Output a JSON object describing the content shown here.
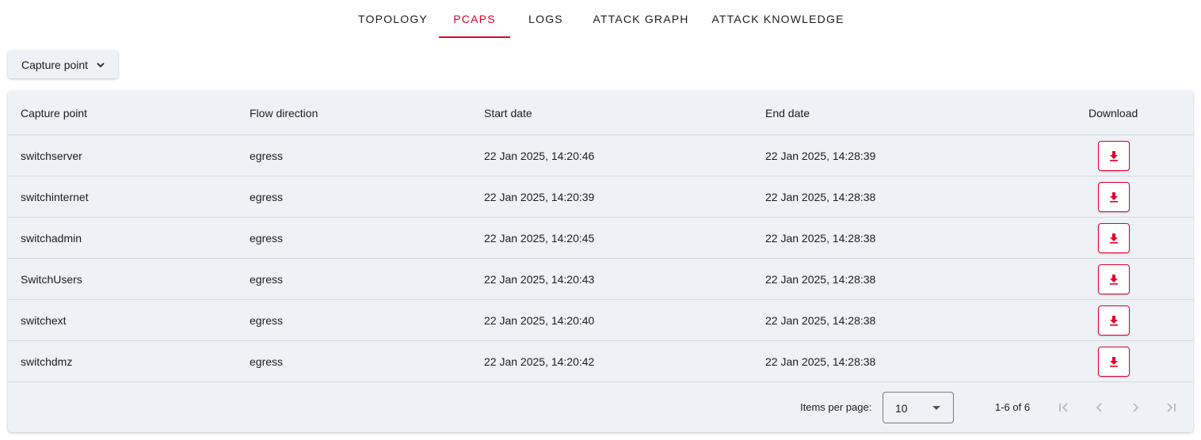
{
  "tabs": [
    {
      "label": "TOPOLOGY",
      "active": false
    },
    {
      "label": "PCAPS",
      "active": true
    },
    {
      "label": "LOGS",
      "active": false
    },
    {
      "label": "ATTACK GRAPH",
      "active": false
    },
    {
      "label": "ATTACK KNOWLEDGE",
      "active": false
    }
  ],
  "filter": {
    "label": "Capture point",
    "icon": "chevron-down-icon"
  },
  "table": {
    "headers": {
      "capture_point": "Capture point",
      "flow_direction": "Flow direction",
      "start_date": "Start date",
      "end_date": "End date",
      "download": "Download"
    },
    "rows": [
      {
        "capture_point": "switchserver",
        "flow_direction": "egress",
        "start_date": "22 Jan 2025, 14:20:46",
        "end_date": "22 Jan 2025, 14:28:39"
      },
      {
        "capture_point": "switchinternet",
        "flow_direction": "egress",
        "start_date": "22 Jan 2025, 14:20:39",
        "end_date": "22 Jan 2025, 14:28:38"
      },
      {
        "capture_point": "switchadmin",
        "flow_direction": "egress",
        "start_date": "22 Jan 2025, 14:20:45",
        "end_date": "22 Jan 2025, 14:28:38"
      },
      {
        "capture_point": "SwitchUsers",
        "flow_direction": "egress",
        "start_date": "22 Jan 2025, 14:20:43",
        "end_date": "22 Jan 2025, 14:28:38"
      },
      {
        "capture_point": "switchext",
        "flow_direction": "egress",
        "start_date": "22 Jan 2025, 14:20:40",
        "end_date": "22 Jan 2025, 14:28:38"
      },
      {
        "capture_point": "switchdmz",
        "flow_direction": "egress",
        "start_date": "22 Jan 2025, 14:20:42",
        "end_date": "22 Jan 2025, 14:28:38"
      }
    ]
  },
  "paginator": {
    "items_per_page_label": "Items per page:",
    "items_per_page_value": "10",
    "range_label": "1-6 of 6"
  },
  "colors": {
    "accent": "#e0002a",
    "surface": "#eef2f6",
    "divider": "#d3d8de",
    "disabled": "#b5b9be"
  }
}
